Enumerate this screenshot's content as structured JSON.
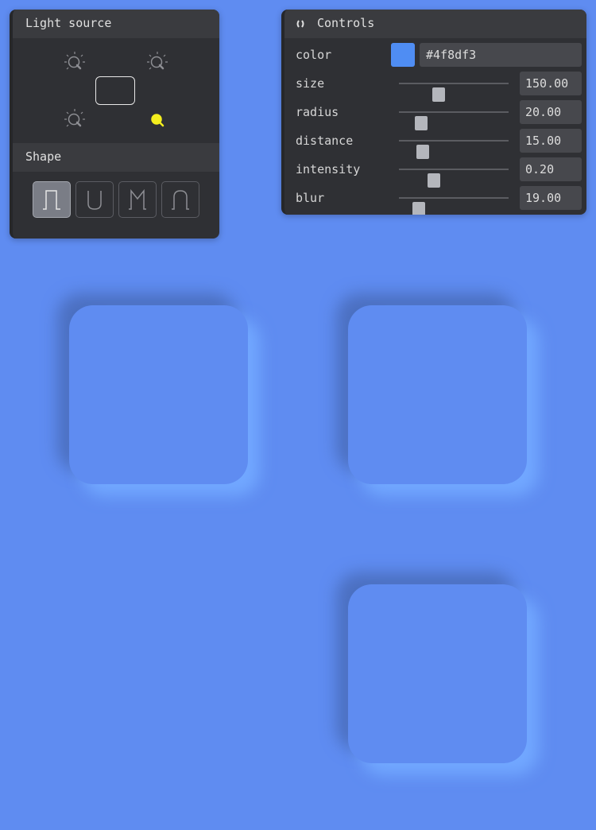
{
  "light_panel": {
    "title": "Light source",
    "bulbs": [
      {
        "position": "top-left",
        "active": false,
        "icon": "bulb-icon"
      },
      {
        "position": "top-right",
        "active": false,
        "icon": "bulb-icon"
      },
      {
        "position": "bottom-left",
        "active": false,
        "icon": "bulb-icon"
      },
      {
        "position": "bottom-right",
        "active": true,
        "icon": "bulb-icon"
      }
    ],
    "shape_title": "Shape",
    "shapes": [
      {
        "icon": "flat-shape-icon",
        "active": true
      },
      {
        "icon": "concave-shape-icon",
        "active": false
      },
      {
        "icon": "convex-shape-icon",
        "active": false
      },
      {
        "icon": "pressed-shape-icon",
        "active": false
      }
    ]
  },
  "controls": {
    "title": "Controls",
    "color_label": "color",
    "color_value": "#4f8df3",
    "sliders": [
      {
        "label": "size",
        "value": "150.00",
        "fraction": 0.36
      },
      {
        "label": "radius",
        "value": "20.00",
        "fraction": 0.2
      },
      {
        "label": "distance",
        "value": "15.00",
        "fraction": 0.22
      },
      {
        "label": "intensity",
        "value": "0.20",
        "fraction": 0.32
      },
      {
        "label": "blur",
        "value": "19.00",
        "fraction": 0.18
      }
    ]
  },
  "colors": {
    "background": "#5f8cf1",
    "panel": "#2f3034",
    "active_bulb": "#f4ee1e",
    "inactive_bulb": "#8d8e93"
  }
}
